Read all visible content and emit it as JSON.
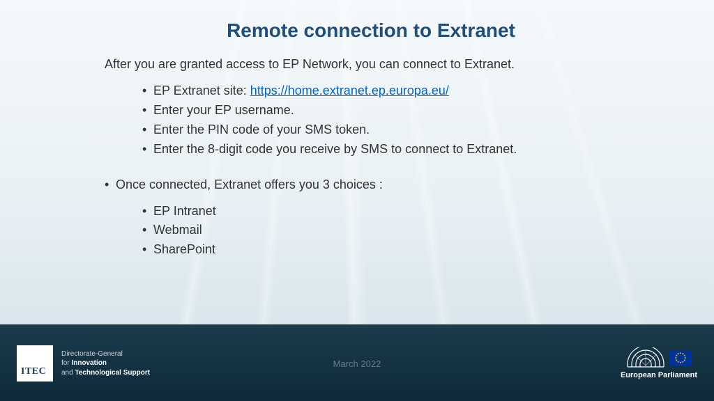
{
  "title": "Remote connection to Extranet",
  "intro": "After you are granted access to EP Network, you can connect to Extranet.",
  "steps": {
    "b1_pre": "EP Extranet site: ",
    "b1_link": "https://home.extranet.ep.europa.eu/",
    "b2": "Enter your EP username.",
    "b3": "Enter the PIN code of your SMS token.",
    "b4": "Enter the 8-digit code you receive by SMS to connect to Extranet."
  },
  "once_connected": "Once connected, Extranet offers you 3 choices :",
  "choices": {
    "c1": "EP Intranet",
    "c2": "Webmail",
    "c3": "SharePoint"
  },
  "footer": {
    "itec": "ITEC",
    "dir_line1": "Directorate-General",
    "dir_line2_prefix": "for ",
    "dir_line2_bold": "Innovation",
    "dir_line3_prefix": "and ",
    "dir_line3_bold": "Technological Support",
    "date": "March 2022",
    "ep_name": "European Parliament"
  }
}
